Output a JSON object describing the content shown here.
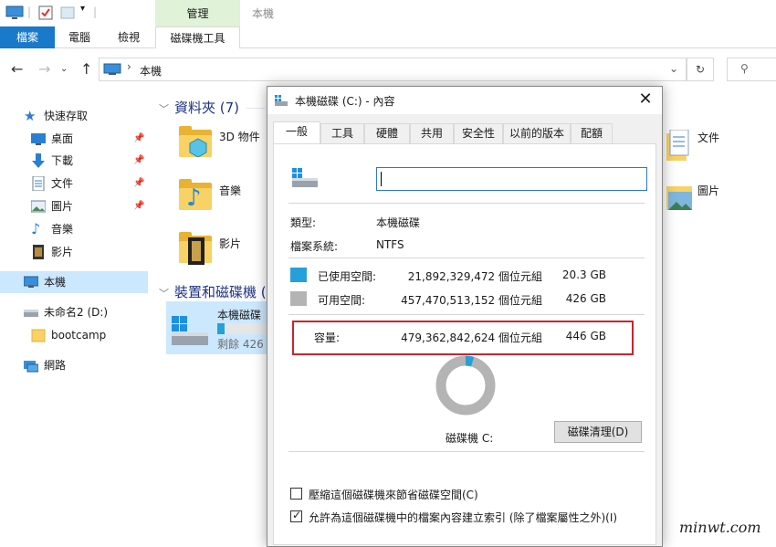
{
  "ribbon": {
    "context_group": "管理",
    "window_title": "本機",
    "tabs": [
      "檔案",
      "電腦",
      "檢視",
      "磁碟機工具"
    ]
  },
  "address": {
    "path": "本機"
  },
  "sidebar": {
    "items": [
      "快速存取",
      "桌面",
      "下載",
      "文件",
      "圖片",
      "音樂",
      "影片",
      "本機",
      "未命名2 (D:)",
      "bootcamp",
      "網路"
    ]
  },
  "main": {
    "folders_header": "資料夾 (7)",
    "folders": [
      "3D 物件",
      "音樂",
      "影片",
      "文件",
      "圖片"
    ],
    "drives_header": "裝置和磁碟機 (",
    "drive_name": "本機磁碟",
    "drive_free": "剩餘 426"
  },
  "dialog": {
    "title": "本機磁碟 (C:) - 內容",
    "tabs": [
      "一般",
      "工具",
      "硬體",
      "共用",
      "安全性",
      "以前的版本",
      "配額"
    ],
    "name_value": "",
    "type_label": "類型:",
    "type_value": "本機磁碟",
    "fs_label": "檔案系統:",
    "fs_value": "NTFS",
    "used_label": "已使用空間:",
    "used_bytes": "21,892,329,472 個位元組",
    "used_size": "20.3 GB",
    "free_label": "可用空間:",
    "free_bytes": "457,470,513,152 個位元組",
    "free_size": "426 GB",
    "capacity_label": "容量:",
    "capacity_bytes": "479,362,842,624 個位元組",
    "capacity_size": "446 GB",
    "drive_caption": "磁碟機 C:",
    "cleanup_button": "磁碟清理(D)",
    "compress_label": "壓縮這個磁碟機來節省磁碟空間(C)",
    "index_label": "允許為這個磁碟機中的檔案內容建立索引 (除了檔案屬性之外)(I)"
  },
  "colors": {
    "used": "#26a0da",
    "free": "#b4b4b4",
    "accent": "#1979ca",
    "highlight_box": "#c9252c"
  },
  "watermark": "minwt.com"
}
